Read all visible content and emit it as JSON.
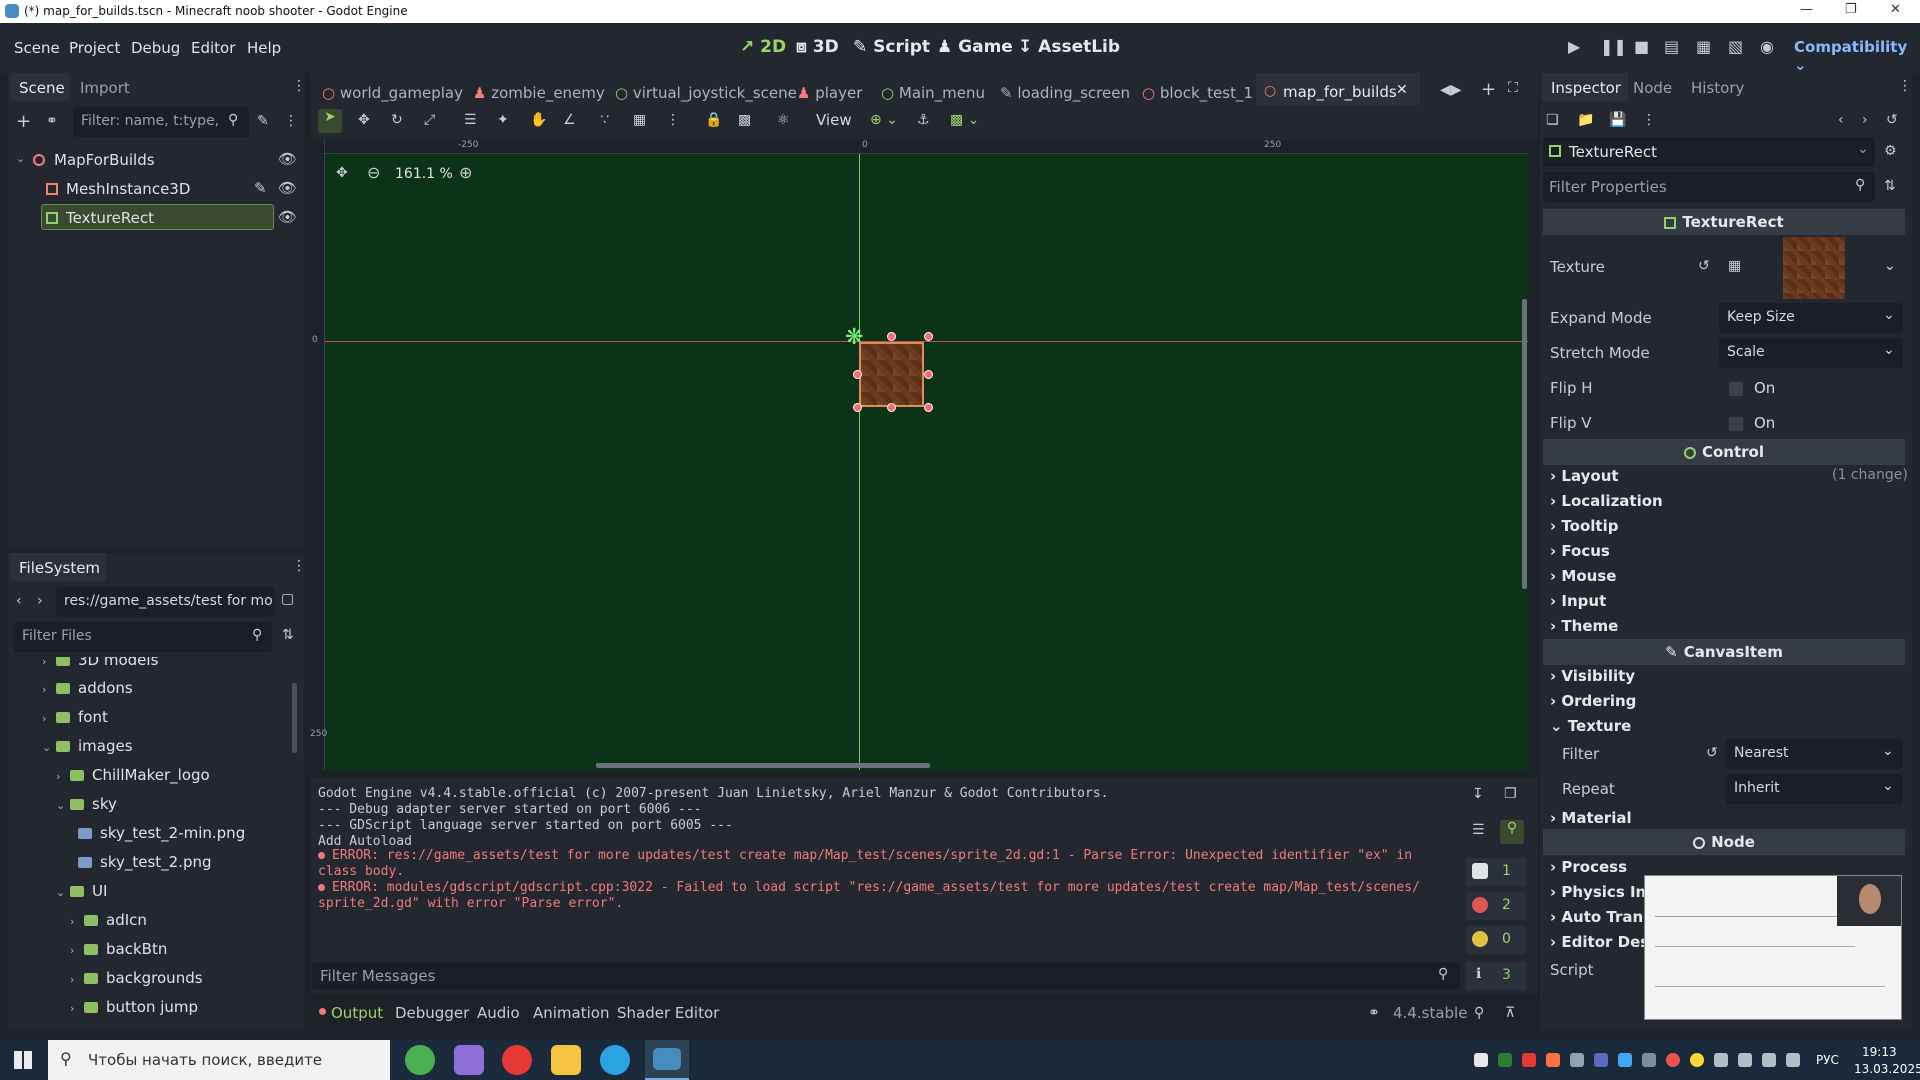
{
  "window": {
    "title": "(*) map_for_builds.tscn - Minecraft noob shooter - Godot Engine"
  },
  "menu": [
    "Scene",
    "Project",
    "Debug",
    "Editor",
    "Help"
  ],
  "workspaces": [
    "2D",
    "3D",
    "Script",
    "Game",
    "AssetLib"
  ],
  "renderer": "Compatibility",
  "scene_dock": {
    "tabs": [
      "Scene",
      "Import"
    ],
    "filter_placeholder": "Filter: name, t:type,",
    "nodes": [
      "MapForBuilds",
      "MeshInstance3D",
      "TextureRect"
    ]
  },
  "filesystem": {
    "tab": "FileSystem",
    "path": "res://game_assets/test for mo",
    "filter_placeholder": "Filter Files",
    "items": [
      "3D models",
      "addons",
      "font",
      "images",
      "ChillMaker_logo",
      "sky",
      "sky_test_2-min.png",
      "sky_test_2.png",
      "UI",
      "adIcn",
      "backBtn",
      "backgrounds",
      "button jump"
    ]
  },
  "editor_tabs": [
    "world_gameplay",
    "zombie_enemy",
    "virtual_joystick_scene",
    "player",
    "Main_menu",
    "loading_screen",
    "block_test_1",
    "map_for_builds"
  ],
  "toolbar": {
    "view_label": "View"
  },
  "viewport": {
    "zoom": "161.1 %",
    "ruler_top": [
      "-250",
      "0",
      "250"
    ],
    "ruler_left": [
      "0",
      "250"
    ]
  },
  "output": {
    "lines": [
      {
        "text": "Godot Engine v4.4.stable.official (c) 2007-present Juan Linietsky, Ariel Manzur & Godot Contributors.",
        "type": "info"
      },
      {
        "text": "--- Debug adapter server started on port 6006 ---",
        "type": "mono"
      },
      {
        "text": "--- GDScript language server started on port 6005 ---",
        "type": "mono"
      },
      {
        "text": "Add Autoload",
        "type": "mono"
      },
      {
        "text": "ERROR: res://game_assets/test for more updates/test create map/Map_test/scenes/sprite_2d.gd:1 - Parse Error: Unexpected identifier \"ex\" in",
        "type": "err"
      },
      {
        "text": "class body.",
        "type": "err2"
      },
      {
        "text": "ERROR: modules/gdscript/gdscript.cpp:3022 - Failed to load script \"res://game_assets/test for more updates/test create map/Map_test/scenes/",
        "type": "err"
      },
      {
        "text": "sprite_2d.gd\" with error \"Parse error\".",
        "type": "err2"
      }
    ],
    "counts": [
      "1",
      "2",
      "0",
      "3"
    ],
    "filter_placeholder": "Filter Messages"
  },
  "bottom_tabs": [
    "Output",
    "Debugger",
    "Audio",
    "Animation",
    "Shader Editor"
  ],
  "version": "4.4.stable",
  "inspector": {
    "tabs": [
      "Inspector",
      "Node",
      "History"
    ],
    "object": "TextureRect",
    "filter_placeholder": "Filter Properties",
    "class_header": "TextureRect",
    "texture_label": "Texture",
    "expand_mode": {
      "label": "Expand Mode",
      "value": "Keep Size"
    },
    "stretch_mode": {
      "label": "Stretch Mode",
      "value": "Scale"
    },
    "flip_h": {
      "label": "Flip H",
      "value": "On"
    },
    "flip_v": {
      "label": "Flip V",
      "value": "On"
    },
    "control_header": "Control",
    "control_sections": [
      "Layout",
      "Localization",
      "Tooltip",
      "Focus",
      "Mouse",
      "Input",
      "Theme"
    ],
    "layout_changes": "(1 change)",
    "canvas_header": "CanvasItem",
    "canvas_sections": [
      "Visibility",
      "Ordering",
      "Texture"
    ],
    "filter": {
      "label": "Filter",
      "value": "Nearest"
    },
    "repeat": {
      "label": "Repeat",
      "value": "Inherit"
    },
    "material": "Material",
    "node_header": "Node",
    "node_sections": [
      "Process",
      "Physics Inte",
      "Auto Transla",
      "Editor Descr"
    ],
    "script_label": "Script"
  },
  "taskbar": {
    "search_placeholder": "Чтобы начать поиск, введите",
    "lang": "РУС",
    "time": "19:13",
    "date": "13.03.2025"
  },
  "colors": {
    "accent": "#9cd36b",
    "viewport_bg": "#0b3318",
    "error": "#f07a7a",
    "texture": "#6b3a1f"
  }
}
